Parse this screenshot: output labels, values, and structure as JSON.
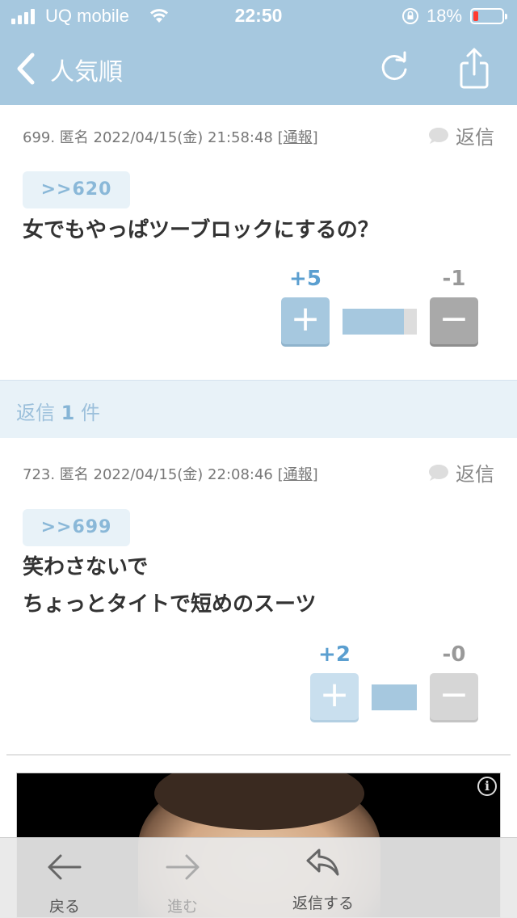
{
  "status_bar": {
    "carrier": "UQ mobile",
    "time": "22:50",
    "battery": "18%"
  },
  "nav": {
    "title": "人気順",
    "back_icon": "chevron-left-icon",
    "reload_icon": "reload-icon",
    "share_icon": "share-icon"
  },
  "comments": [
    {
      "meta_prefix": "699. 匿名 2022/04/15(金) 21:58:48 [",
      "report_label": "通報",
      "meta_suffix": "]",
      "reply_label": "返信",
      "anchor": ">>620",
      "lines": [
        "女でもやっぱツーブロックにするの？"
      ],
      "plus_count": "+5",
      "minus_count": "-1",
      "plus_ratio": 0.83
    },
    {
      "meta_prefix": "723. 匿名 2022/04/15(金) 22:08:46 [",
      "report_label": "通報",
      "meta_suffix": "]",
      "reply_label": "返信",
      "anchor": ">>699",
      "lines": [
        "笑わさないで",
        "ちょっとタイトで短めのスーツ"
      ],
      "plus_count": "+2",
      "minus_count": "-0",
      "plus_ratio": 1.0
    }
  ],
  "replies": {
    "prefix": "返信",
    "count": "1",
    "suffix": "件"
  },
  "toolbar": {
    "back_label": "戻る",
    "forward_label": "進む",
    "reply_label": "返信する"
  },
  "colors": {
    "header": "#a6c8df",
    "accent_blue": "#5b9fd0",
    "minus_gray": "#a9a9a9"
  }
}
